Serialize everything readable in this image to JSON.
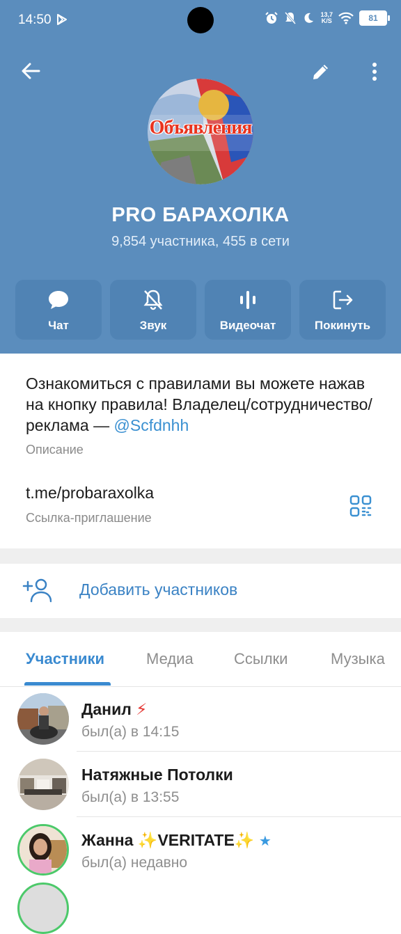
{
  "status_bar": {
    "time": "14:50",
    "net_speed_value": "13,7",
    "net_speed_unit": "K/S",
    "battery": "81"
  },
  "group": {
    "avatar_text": "Объявления",
    "title": "PRO БАРАХОЛКА",
    "subtitle": "9,854 участника, 455 в сети"
  },
  "actions": [
    {
      "label": "Чат",
      "icon": "chat-bubble-icon"
    },
    {
      "label": "Звук",
      "icon": "bell-off-icon"
    },
    {
      "label": "Видеочат",
      "icon": "voice-bars-icon"
    },
    {
      "label": "Покинуть",
      "icon": "leave-icon"
    }
  ],
  "info": {
    "description_text": "Ознакомиться с правилами вы можете нажав на кнопку правила! Владелец/сотрудничество/реклама — ",
    "description_mention": "@Scfdnhh",
    "description_caption": "Описание",
    "invite_link": "t.me/probaraxolka",
    "invite_caption": "Ссылка-приглашение"
  },
  "add_members": {
    "label": "Добавить участников"
  },
  "tabs": [
    {
      "label": "Участники",
      "active": true
    },
    {
      "label": "Медиа",
      "active": false
    },
    {
      "label": "Ссылки",
      "active": false
    },
    {
      "label": "Музыка",
      "active": false
    }
  ],
  "members": [
    {
      "name": "Данил",
      "badge": "⚡",
      "status": "был(а) в 14:15"
    },
    {
      "name": "Натяжные Потолки",
      "badge": "",
      "status": "был(а) в 13:55"
    },
    {
      "name": "Жанна ✨VERITATE✨",
      "badge": "★",
      "status": "был(а) недавно"
    }
  ],
  "colors": {
    "header_bg": "#5b8dbd",
    "action_bg": "#5083b4",
    "accent": "#3a8ad0",
    "mention": "#3a90d1"
  }
}
